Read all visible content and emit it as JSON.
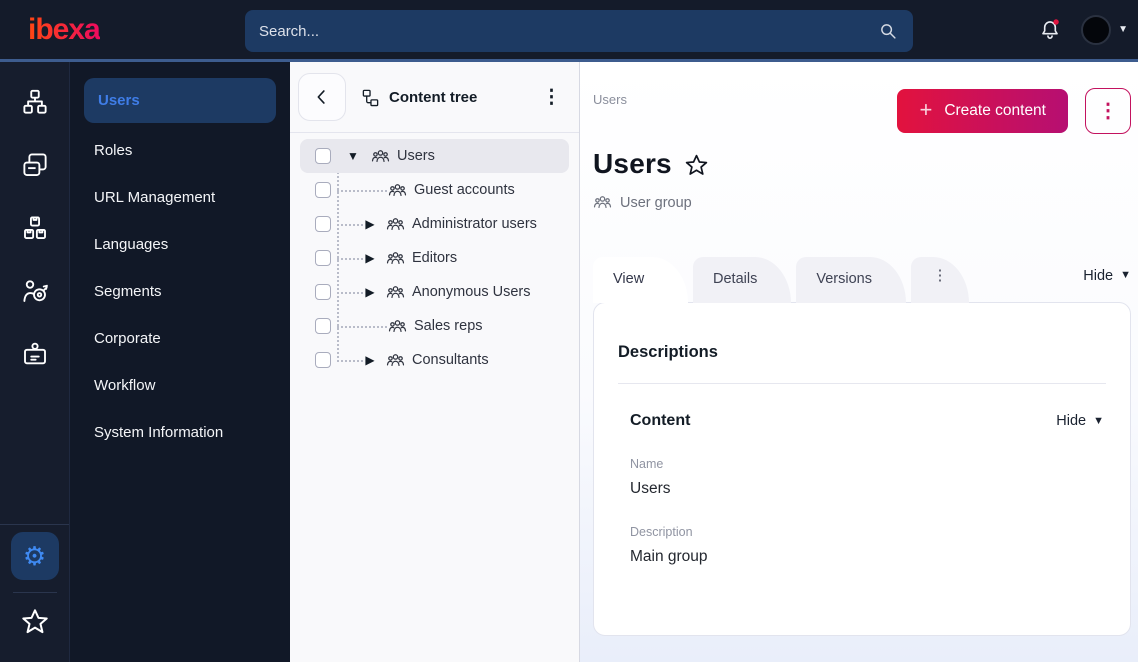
{
  "topbar": {
    "logo_text": "ibexa",
    "search_placeholder": "Search...",
    "icons": {
      "search": "search-icon",
      "notifications": "bell-icon",
      "user": "avatar",
      "menu_caret": "chevron-down-icon"
    },
    "notification_badge_color": "#e0143e"
  },
  "rail": {
    "items": [
      {
        "icon": "sitemap-icon"
      },
      {
        "icon": "content-pages-icon"
      },
      {
        "icon": "product-boxes-icon"
      },
      {
        "icon": "audience-target-icon"
      },
      {
        "icon": "id-badge-icon"
      }
    ],
    "footer": [
      {
        "icon": "gear-icon",
        "active": true,
        "glyph": "⚙"
      },
      {
        "icon": "star-icon",
        "active": false
      }
    ]
  },
  "sidebar": {
    "items": [
      {
        "label": "Users",
        "active": true
      },
      {
        "label": "Roles",
        "active": false
      },
      {
        "label": "URL Management",
        "active": false
      },
      {
        "label": "Languages",
        "active": false
      },
      {
        "label": "Segments",
        "active": false
      },
      {
        "label": "Corporate",
        "active": false
      },
      {
        "label": "Workflow",
        "active": false
      },
      {
        "label": "System Information",
        "active": false
      }
    ]
  },
  "content_tree": {
    "title": "Content tree",
    "items": [
      {
        "label": "Users",
        "state": "expanded",
        "selected": true,
        "depth": 0
      },
      {
        "label": "Guest accounts",
        "state": "leaf",
        "selected": false,
        "depth": 1
      },
      {
        "label": "Administrator users",
        "state": "collapsed",
        "selected": false,
        "depth": 1
      },
      {
        "label": "Editors",
        "state": "collapsed",
        "selected": false,
        "depth": 1
      },
      {
        "label": "Anonymous Users",
        "state": "collapsed",
        "selected": false,
        "depth": 1
      },
      {
        "label": "Sales reps",
        "state": "leaf",
        "selected": false,
        "depth": 1
      },
      {
        "label": "Consultants",
        "state": "collapsed",
        "selected": false,
        "depth": 1
      }
    ]
  },
  "main": {
    "breadcrumb": "Users",
    "create_button_label": "Create content",
    "page_title": "Users",
    "content_type": "User group",
    "tabs": [
      {
        "label": "View",
        "active": true
      },
      {
        "label": "Details",
        "active": false
      },
      {
        "label": "Versions",
        "active": false
      }
    ],
    "hide_label": "Hide",
    "panel": {
      "descriptions_title": "Descriptions",
      "content_group_title": "Content",
      "content_hide_label": "Hide",
      "fields": [
        {
          "label": "Name",
          "value": "Users"
        },
        {
          "label": "Description",
          "value": "Main group"
        }
      ]
    }
  },
  "colors": {
    "topbar_bg": "#141b2a",
    "topbar_underline": "#3d5c8e",
    "sidebar_bg": "#111827",
    "active_item_bg": "#1d3a63",
    "active_blue": "#3f7de8",
    "gear_blue": "#3f8af2",
    "button_gradient_start": "#e2123e",
    "button_gradient_end": "#b60f72",
    "brand_gradient_start": "#ff4713",
    "brand_gradient_end": "#ed0a5f",
    "badge_red": "#e0143e"
  }
}
